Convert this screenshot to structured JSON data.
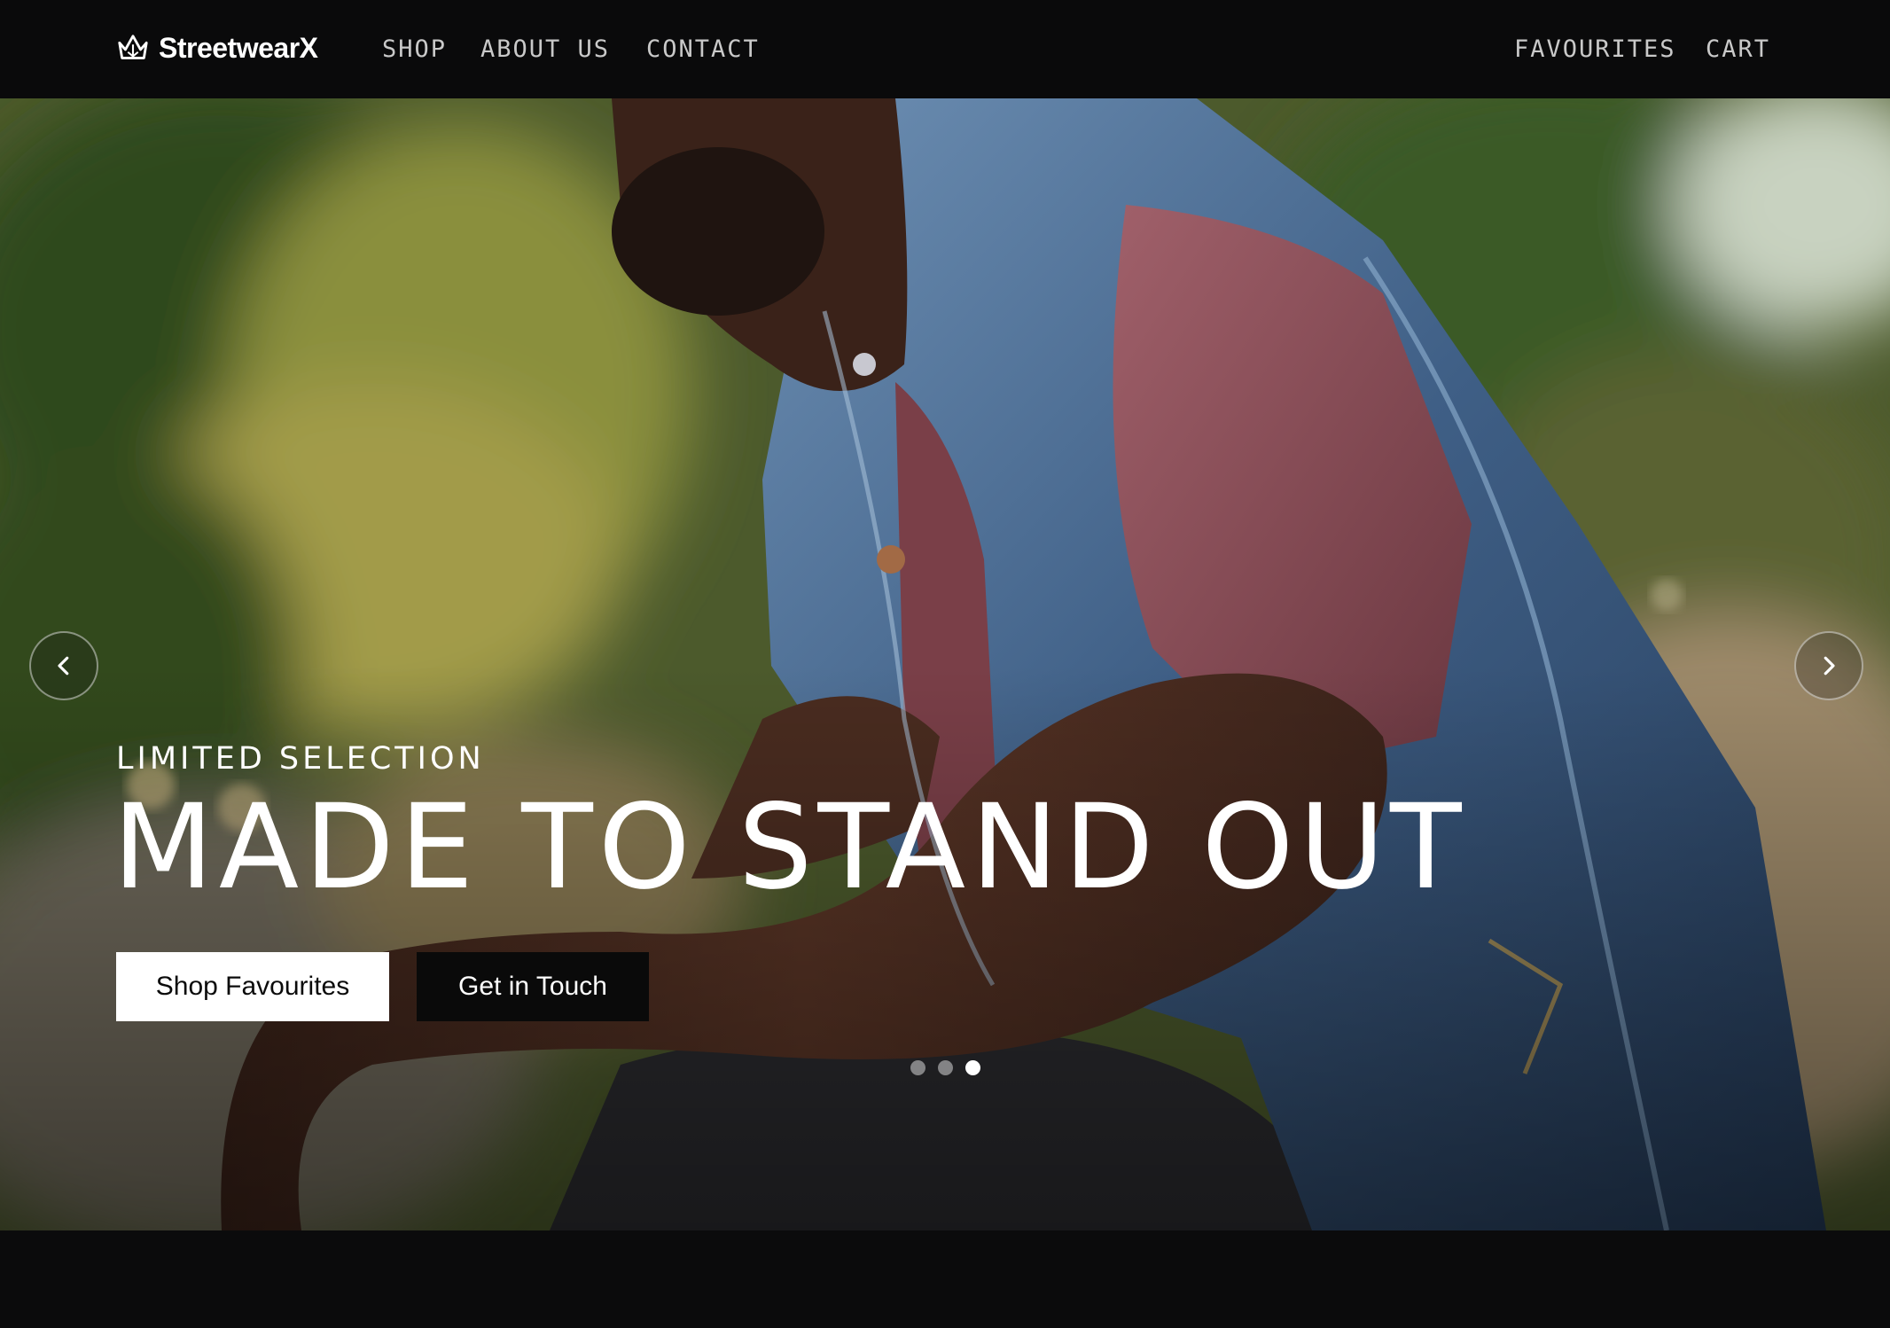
{
  "brand": {
    "name": "StreetwearX",
    "icon": "crown-icon"
  },
  "nav": {
    "left_links": [
      "SHOP",
      "ABOUT US",
      "CONTACT"
    ],
    "right_links": [
      "FAVOURITES",
      "CART"
    ]
  },
  "hero": {
    "eyebrow": "LIMITED SELECTION",
    "headline": "MADE TO STAND OUT",
    "primary_button": "Shop Favourites",
    "secondary_button": "Get in Touch",
    "prev_icon": "chevron-left-icon",
    "next_icon": "chevron-right-icon",
    "slide_count": 3,
    "active_slide": 3
  },
  "colors": {
    "nav_bg": "#0a0a0b",
    "nav_text": "#c9c9c9",
    "white": "#ffffff",
    "dark_button": "#0a0a0a"
  }
}
